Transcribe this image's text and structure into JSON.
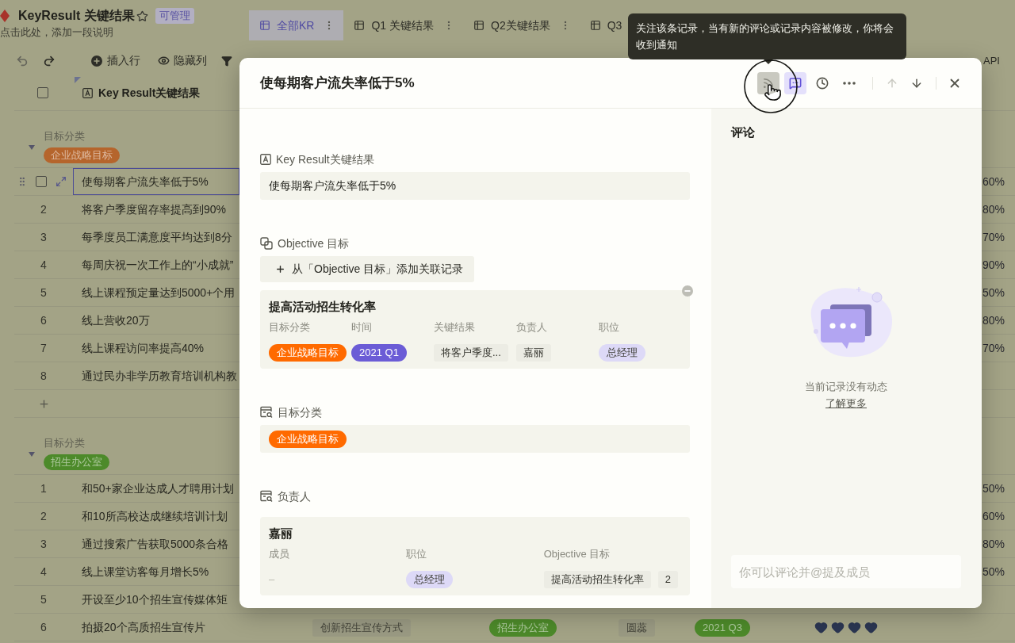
{
  "header": {
    "title": "KeyResult 关键结果",
    "starred": false,
    "permission": "可管理",
    "description": "点击此处，添加一段说明"
  },
  "views": [
    {
      "label": "全部KR",
      "selected": true
    },
    {
      "label": "Q1 关键结果",
      "selected": false
    },
    {
      "label": "Q2关键结果",
      "selected": false
    },
    {
      "label": "Q3",
      "selected": false
    }
  ],
  "toolbar": {
    "items": [
      {
        "kind": "insert",
        "label": "插入行"
      },
      {
        "kind": "hide",
        "label": "隐藏列"
      },
      {
        "kind": "filter"
      }
    ],
    "api_label": "API"
  },
  "table": {
    "primary_column": "Key Result关键结果",
    "select_all_checked": false,
    "groups": [
      {
        "field": "目标分类",
        "value": "企业战略目标",
        "color": "#b5652c",
        "expanded": true,
        "rows": [
          {
            "kind": "record",
            "hovered": true,
            "selected": true,
            "checked": false,
            "text": "使每期客户流失率低于5%",
            "progress": "60%"
          },
          {
            "kind": "record",
            "hovered": false,
            "selected": false,
            "checked": false,
            "number": "2",
            "text": "将客户季度留存率提高到90%",
            "progress": "80%"
          },
          {
            "kind": "record",
            "hovered": false,
            "selected": false,
            "checked": false,
            "number": "3",
            "text": "每季度员工满意度平均达到8分",
            "progress": "70%"
          },
          {
            "kind": "record",
            "hovered": false,
            "selected": false,
            "checked": false,
            "number": "4",
            "text": "每周庆祝一次工作上的“小成就”",
            "progress": "90%"
          },
          {
            "kind": "record",
            "hovered": false,
            "selected": false,
            "checked": false,
            "number": "5",
            "text": "线上课程预定量达到5000+个用",
            "progress": "50%"
          },
          {
            "kind": "record",
            "hovered": false,
            "selected": false,
            "checked": false,
            "number": "6",
            "text": "线上营收20万",
            "progress": "80%"
          },
          {
            "kind": "record",
            "hovered": false,
            "selected": false,
            "checked": false,
            "number": "7",
            "text": "线上课程访问率提高40%",
            "progress": "70%"
          },
          {
            "kind": "record",
            "hovered": false,
            "selected": false,
            "checked": false,
            "number": "8",
            "text": "通过民办非学历教育培训机构教"
          },
          {
            "kind": "add"
          }
        ]
      },
      {
        "field": "目标分类",
        "value": "招生办公室",
        "color": "#4d8a2a",
        "expanded": true,
        "rows": [
          {
            "kind": "record",
            "hovered": false,
            "selected": false,
            "checked": false,
            "number": "1",
            "text": "和50+家企业达成人才聘用计划",
            "progress": "50%"
          },
          {
            "kind": "record",
            "hovered": false,
            "selected": false,
            "checked": false,
            "number": "2",
            "text": "和10所高校达成继续培训计划",
            "progress": "60%"
          },
          {
            "kind": "record",
            "hovered": false,
            "selected": false,
            "checked": false,
            "number": "3",
            "text": "通过搜索广告获取5000条合格",
            "progress": "80%"
          },
          {
            "kind": "record",
            "hovered": false,
            "selected": false,
            "checked": false,
            "number": "4",
            "text": "线上课堂访客每月增长5%",
            "progress": "50%"
          },
          {
            "kind": "record",
            "hovered": false,
            "selected": false,
            "checked": false,
            "number": "5",
            "text": "开设至少10个招生宣传媒体矩"
          },
          {
            "kind": "record",
            "hovered": false,
            "selected": false,
            "checked": false,
            "number": "6",
            "text": "拍摄20个高质招生宣传片",
            "cells": [
              {
                "kind": "link",
                "text": "创新招生宣传方式"
              },
              {
                "kind": "option",
                "text": "招生办公室",
                "color": "#4d8a2a"
              },
              {
                "kind": "link",
                "text": "圆蕊"
              },
              {
                "kind": "option",
                "text": "2021 Q3",
                "color": "#4d8a2a"
              }
            ],
            "stars": 4
          }
        ]
      }
    ]
  },
  "record": {
    "title": "使每期客户流失率低于5%",
    "follow_hovered": true,
    "comments_open": true,
    "previous_disabled": true,
    "next_disabled": false,
    "fields": [
      {
        "kind": "text",
        "label": "Key Result关键结果",
        "value": "使每期客户流失率低于5%"
      },
      {
        "kind": "link",
        "label": "Objective 目标",
        "add_button": "从「Objective 目标」添加关联记录",
        "records": [
          {
            "title": "提高活动招生转化率",
            "columns": [
              {
                "label": "目标分类",
                "values": [
                  {
                    "kind": "option",
                    "text": "企业战略目标",
                    "color": "#ff6a00"
                  }
                ]
              },
              {
                "label": "时间",
                "values": [
                  {
                    "kind": "option",
                    "text": "2021 Q1",
                    "color": "#6b5cd6"
                  }
                ]
              },
              {
                "label": "关键结果",
                "values": [
                  {
                    "kind": "link",
                    "text": "将客户季度..."
                  }
                ]
              },
              {
                "label": "负责人",
                "values": [
                  {
                    "kind": "link",
                    "text": "嘉丽"
                  }
                ]
              },
              {
                "label": "职位",
                "values": [
                  {
                    "kind": "option",
                    "text": "总经理",
                    "color": "#ddd9f7"
                  }
                ]
              }
            ]
          }
        ]
      },
      {
        "kind": "lookup",
        "label": "目标分类",
        "values": [
          {
            "kind": "option",
            "text": "企业战略目标",
            "color": "#ff6a00"
          }
        ]
      },
      {
        "kind": "lookup",
        "label": "负责人",
        "records": [
          {
            "title": "嘉丽",
            "columns": [
              {
                "label": "成员",
                "values": [
                  {
                    "kind": "plain",
                    "text": "–"
                  }
                ]
              },
              {
                "label": "职位",
                "values": [
                  {
                    "kind": "option",
                    "text": "总经理",
                    "color": "#ddd9f7"
                  }
                ]
              },
              {
                "label": "Objective 目标",
                "values": [
                  {
                    "kind": "link",
                    "text": "提高活动招生转化率"
                  },
                  {
                    "kind": "link",
                    "text": "2"
                  }
                ]
              }
            ]
          }
        ]
      }
    ]
  },
  "comments": {
    "title": "评论",
    "empty_text": "当前记录没有动态",
    "learn_more": "了解更多",
    "placeholder": "你可以评论并@提及成员"
  },
  "tooltip": {
    "text": "关注该条记录，当有新的评论或记录内容被修改，你将会收到通知"
  }
}
